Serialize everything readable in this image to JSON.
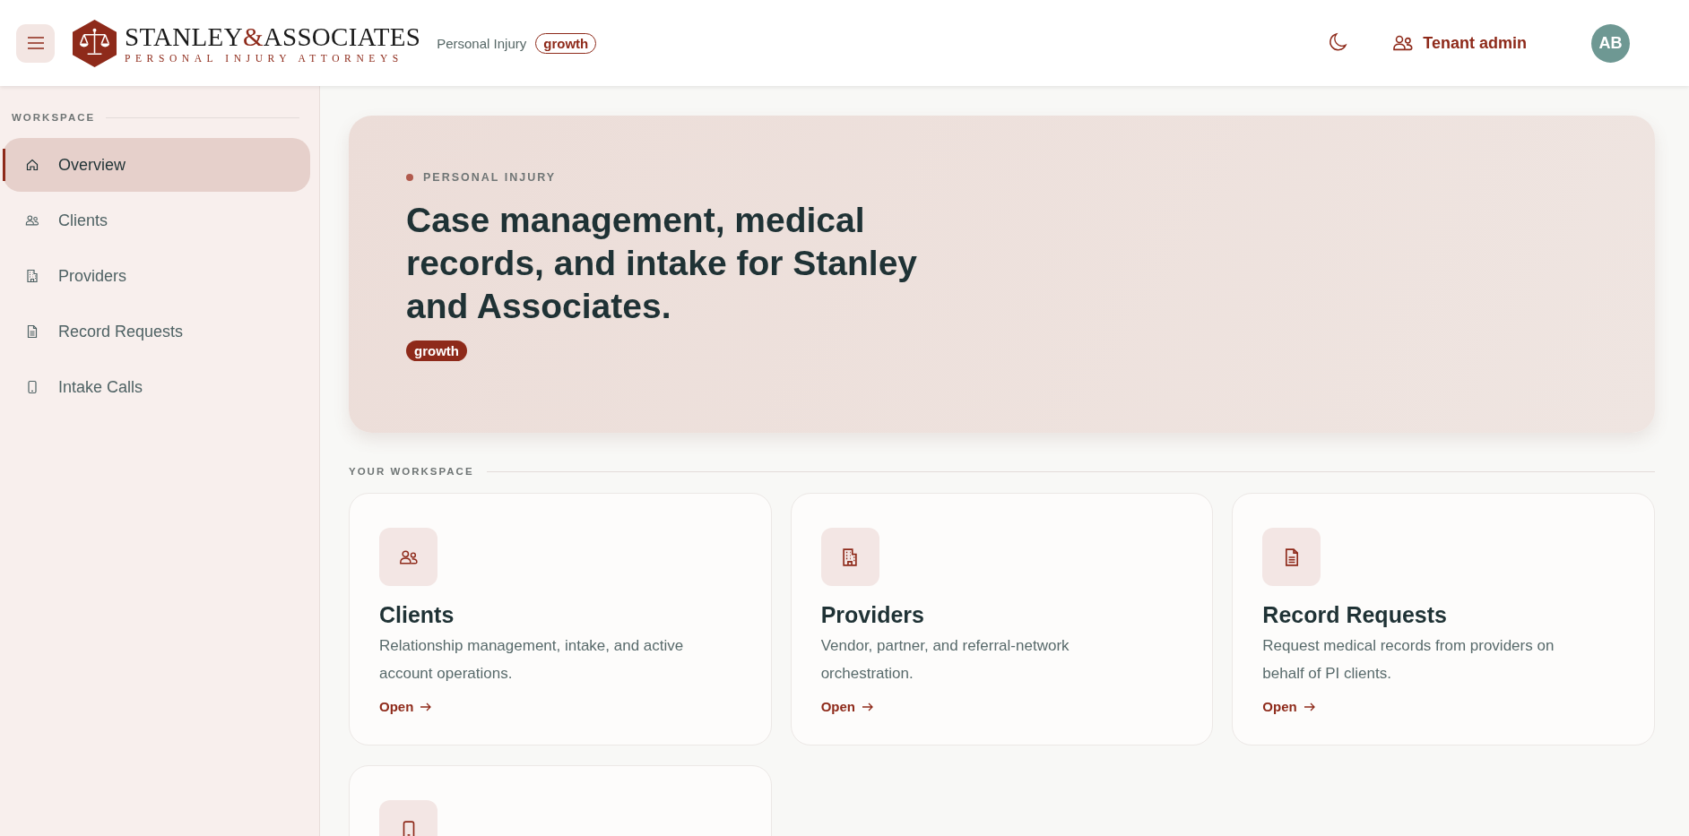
{
  "header": {
    "logo": {
      "name_1": "STANLEY",
      "ampersand": "&",
      "name_2": "ASSOCIATES",
      "tagline": "PERSONAL INJURY ATTORNEYS"
    },
    "practice": "Personal Injury",
    "plan": "growth",
    "role": "Tenant admin",
    "avatar": "AB"
  },
  "sidebar": {
    "section": "WORKSPACE",
    "items": [
      {
        "label": "Overview",
        "selected": true
      },
      {
        "label": "Clients",
        "selected": false
      },
      {
        "label": "Providers",
        "selected": false
      },
      {
        "label": "Record Requests",
        "selected": false
      },
      {
        "label": "Intake Calls",
        "selected": false
      }
    ]
  },
  "hero": {
    "kicker": "PERSONAL INJURY",
    "title": "Case management, medical records, and intake for Stanley and Associates.",
    "plan": "growth"
  },
  "workspace": {
    "label": "YOUR WORKSPACE",
    "cards": [
      {
        "title": "Clients",
        "description": "Relationship management, intake, and active account operations.",
        "link": "Open"
      },
      {
        "title": "Providers",
        "description": "Vendor, partner, and referral-network orchestration.",
        "link": "Open"
      },
      {
        "title": "Record Requests",
        "description": "Request medical records from providers on behalf of PI clients.",
        "link": "Open"
      }
    ]
  }
}
